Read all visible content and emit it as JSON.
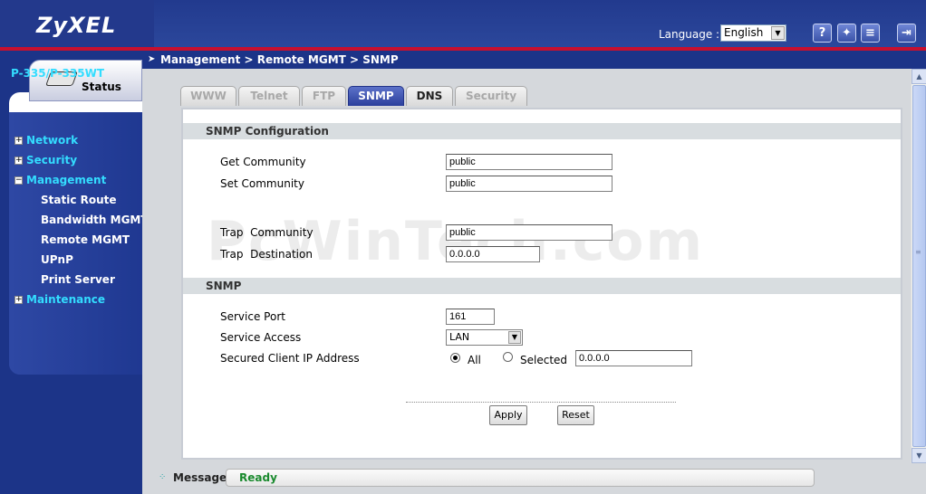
{
  "header": {
    "logo": "ZyXEL",
    "language_label": "Language :",
    "language_value": "English",
    "icons": [
      "help-icon",
      "wizard-icon",
      "notes-icon",
      "logout-icon"
    ]
  },
  "sidebar": {
    "status_tab": "Status",
    "model": "P-335/P-335WT",
    "items": [
      {
        "label": "Network",
        "expander": "+"
      },
      {
        "label": "Security",
        "expander": "+"
      },
      {
        "label": "Management",
        "expander": "−"
      },
      {
        "label": "Maintenance",
        "expander": "+"
      }
    ],
    "subitems": [
      "Static Route",
      "Bandwidth MGMT",
      "Remote MGMT",
      "UPnP",
      "Print Server"
    ]
  },
  "breadcrumb": "Management > Remote MGMT > SNMP",
  "tabs": [
    "WWW",
    "Telnet",
    "FTP",
    "SNMP",
    "DNS",
    "Security"
  ],
  "active_tab": "SNMP",
  "snmp_config": {
    "heading": "SNMP Configuration",
    "get_community_label": "Get Community",
    "get_community_value": "public",
    "set_community_label": "Set Community",
    "set_community_value": "public",
    "trap_community_label": "Trap  Community",
    "trap_community_value": "public",
    "trap_destination_label": "Trap  Destination",
    "trap_destination_value": "0.0.0.0"
  },
  "snmp": {
    "heading": "SNMP",
    "service_port_label": "Service Port",
    "service_port_value": "161",
    "service_access_label": "Service Access",
    "service_access_value": "LAN",
    "secured_ip_label": "Secured Client IP Address",
    "radio_all": "All",
    "radio_selected": "Selected",
    "selected_ip_value": "0.0.0.0"
  },
  "buttons": {
    "apply": "Apply",
    "reset": "Reset"
  },
  "watermark": "PcWinTech.com",
  "status": {
    "label": "Message",
    "value": "Ready"
  },
  "colors": {
    "header": "#223a8e",
    "accent_red": "#c8102e",
    "menu_text": "#33ddff",
    "ready": "#1a8a2e"
  }
}
